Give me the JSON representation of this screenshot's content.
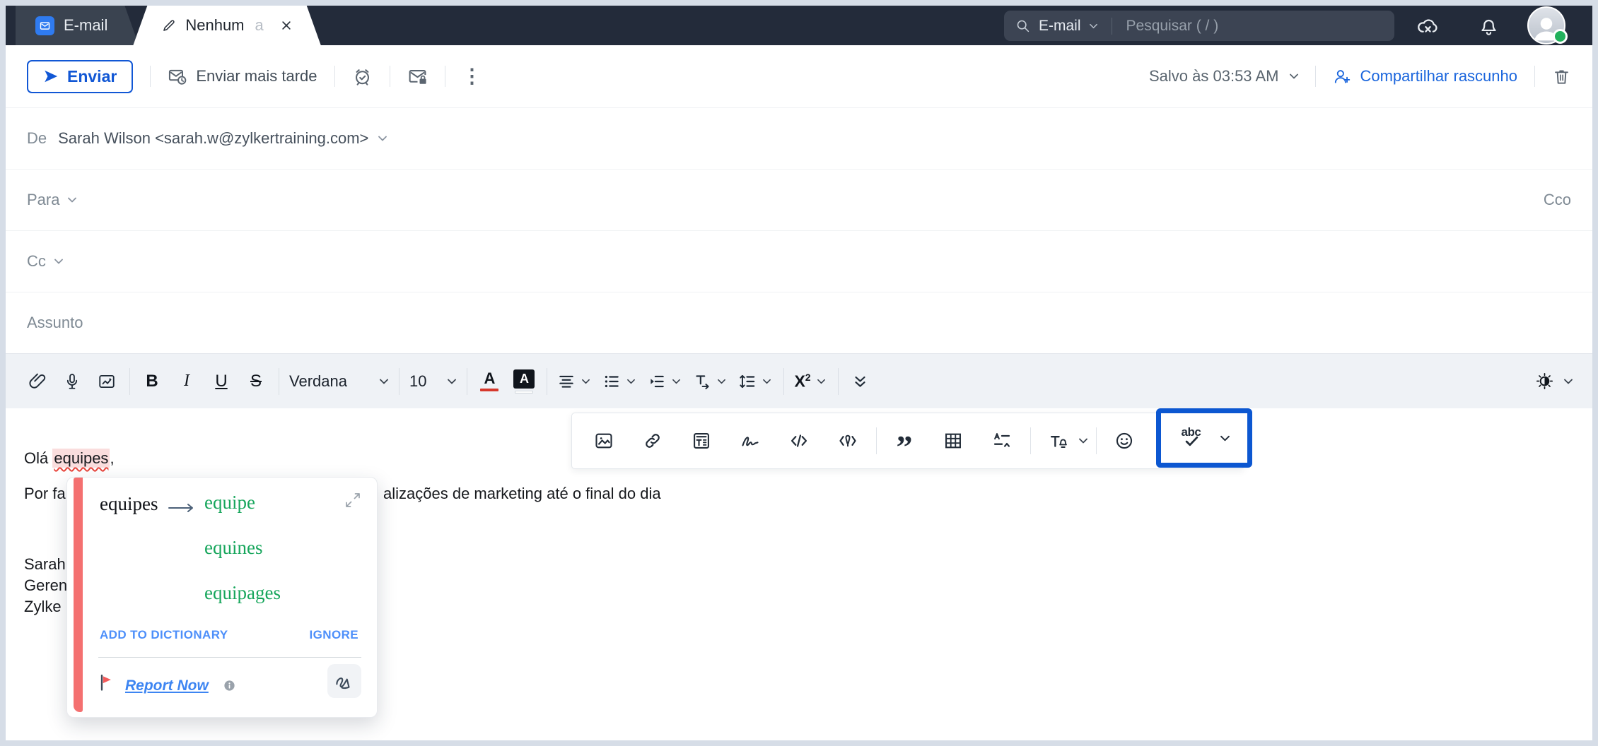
{
  "topbar": {
    "mail_tab": "E-mail",
    "compose_tab": "Nenhum",
    "compose_tab_suffix": "a",
    "search_scope": "E-mail",
    "search_placeholder": "Pesquisar ( / )"
  },
  "actionbar": {
    "send": "Enviar",
    "send_later": "Enviar mais tarde",
    "more_glyph": "⋮",
    "saved_status": "Salvo às 03:53 AM",
    "share_draft": "Compartilhar rascunho"
  },
  "fields": {
    "from_label": "De",
    "from_value": "Sarah Wilson <sarah.w@zylkertraining.com>",
    "to_label": "Para",
    "bcc_label": "Cco",
    "cc_label": "Cc",
    "subject_label": "Assunto"
  },
  "format": {
    "font_family": "Verdana",
    "font_size": "10",
    "bold": "B",
    "italic": "I",
    "underline": "U",
    "strikethrough": "S",
    "font_color": "A",
    "highlight": "A",
    "sup_base": "X",
    "sup_exp": "2",
    "quote_glyph": "”"
  },
  "body": {
    "line1_pre": "Olá ",
    "line1_word": "equipes",
    "line1_post": ",",
    "line2_left": "Por fa",
    "line2_right": "alizações de marketing até o final do dia",
    "sig_line1": "Sarah",
    "sig_line2": "Geren",
    "sig_line3": "Zylke"
  },
  "popup": {
    "word": "equipes",
    "suggestions": [
      "equipe",
      "equines",
      "equipages"
    ],
    "add_to_dictionary": "ADD TO DICTIONARY",
    "ignore": "IGNORE",
    "report": "Report Now"
  },
  "colors": {
    "accent_blue": "#1157d5",
    "selection_box_blue": "#0c57d1",
    "suggestion_green": "#17a65c",
    "spell_error_red": "#e8453c",
    "popup_strip_red": "#f47070",
    "link_blue": "#3d85f2"
  }
}
